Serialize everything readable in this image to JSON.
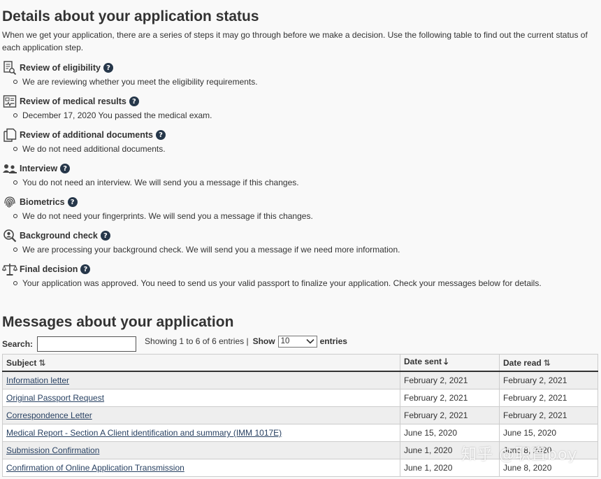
{
  "status_section": {
    "title": "Details about your application status",
    "intro": "When we get your application, there are a series of steps it may go through before we make a decision. Use the following table to find out the current status of each application step.",
    "help_glyph": "?",
    "steps": [
      {
        "icon": "eligibility-icon",
        "title": "Review of eligibility",
        "desc": "We are reviewing whether you meet the eligibility requirements."
      },
      {
        "icon": "medical-icon",
        "title": "Review of medical results",
        "desc": "December 17, 2020 You passed the medical exam."
      },
      {
        "icon": "documents-icon",
        "title": "Review of additional documents",
        "desc": "We do not need additional documents."
      },
      {
        "icon": "interview-icon",
        "title": "Interview",
        "desc": "You do not need an interview. We will send you a message if this changes."
      },
      {
        "icon": "fingerprint-icon",
        "title": "Biometrics",
        "desc": "We do not need your fingerprints. We will send you a message if this changes."
      },
      {
        "icon": "background-check-icon",
        "title": "Background check",
        "desc": "We are processing your background check. We will send you a message if we need more information."
      },
      {
        "icon": "scales-icon",
        "title": "Final decision",
        "desc": "Your application was approved. You need to send us your valid passport to finalize your application. Check your messages below for details."
      }
    ]
  },
  "messages_section": {
    "title": "Messages about your application",
    "search_label": "Search:",
    "search_value": "",
    "info": "Showing 1 to 6 of 6 entries |",
    "show_label": "Show",
    "show_value": "10",
    "entries_label": "entries",
    "columns": {
      "subject": "Subject",
      "date_sent": "Date sent",
      "date_read": "Date read"
    },
    "rows": [
      {
        "subject": "Information letter",
        "sent": "February 2, 2021",
        "read": "February 2, 2021"
      },
      {
        "subject": "Original Passport Request",
        "sent": "February 2, 2021",
        "read": "February 2, 2021"
      },
      {
        "subject": "Correspondence Letter",
        "sent": "February 2, 2021",
        "read": "February 2, 2021"
      },
      {
        "subject": "Medical Report - Section A Client identification and summary (IMM 1017E)",
        "sent": "June 15, 2020",
        "read": "June 15, 2020"
      },
      {
        "subject": "Submission Confirmation",
        "sent": "June 1, 2020",
        "read": "June 8, 2020"
      },
      {
        "subject": "Confirmation of Online Application Transmission",
        "sent": "June 1, 2020",
        "read": "June 8, 2020"
      }
    ]
  },
  "watermark": "知乎 @职直boy"
}
